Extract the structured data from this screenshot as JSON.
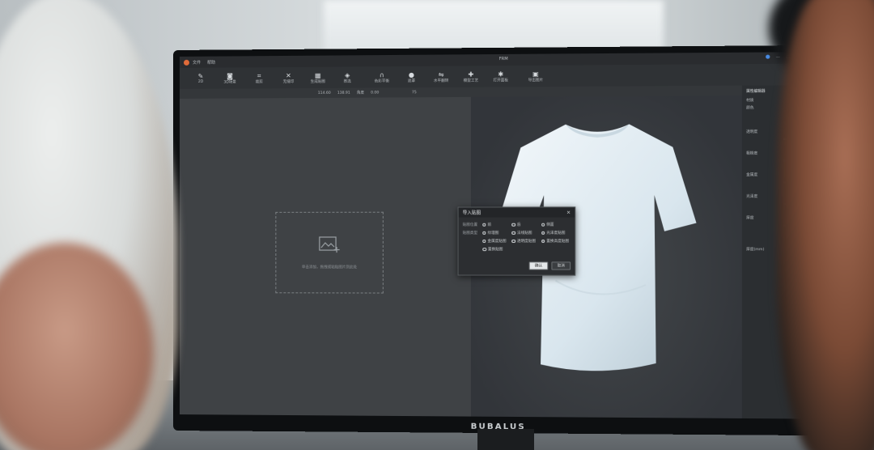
{
  "app": {
    "window_title": "FRM",
    "menu": [
      "文件",
      "帮助"
    ],
    "brand": "BUBALUS"
  },
  "toolbar": {
    "tools": [
      {
        "label": "2D",
        "icon": "pen-icon"
      },
      {
        "label": "3D场景",
        "icon": "camera-icon"
      },
      {
        "label": "裁剪",
        "icon": "crop-icon"
      },
      {
        "label": "无缝印",
        "icon": "pattern-icon"
      },
      {
        "label": "生成贴图",
        "icon": "grid-icon"
      },
      {
        "label": "拣选",
        "icon": "pick-icon"
      },
      {
        "label": "色彩平衡",
        "icon": "headphone-icon"
      },
      {
        "label": "遮罩",
        "icon": "person-icon"
      },
      {
        "label": "水平翻转",
        "icon": "flip-icon"
      },
      {
        "label": "模型工艺",
        "icon": "plus-icon"
      },
      {
        "label": "打开面板",
        "icon": "gear-icon"
      },
      {
        "label": "导出图片",
        "icon": "export-icon"
      }
    ]
  },
  "subbar": {
    "width_value": "114.60",
    "height_value": "138.91",
    "angle_label": "角度",
    "angle_value": "0.00",
    "zoom_value": "75"
  },
  "canvas2d": {
    "hint": "单击添加，拖拽或粘贴图片到此处"
  },
  "dialog": {
    "title": "导入贴图",
    "close": "✕",
    "row1_label": "贴图位置",
    "row1_options": [
      {
        "label": "前",
        "selected": false
      },
      {
        "label": "后",
        "selected": true
      },
      {
        "label": "侧面",
        "selected": false
      }
    ],
    "row2_label": "贴图类型",
    "row2_options": [
      {
        "label": "纹理图",
        "selected": false
      },
      {
        "label": "法线贴图",
        "selected": true
      },
      {
        "label": "光泽度贴图",
        "selected": true
      }
    ],
    "row3_options": [
      {
        "label": "金属度贴图",
        "selected": false
      },
      {
        "label": "透明度贴图",
        "selected": true
      },
      {
        "label": "置换高度贴图",
        "selected": true
      }
    ],
    "row4_options": [
      {
        "label": "置换贴图",
        "selected": false
      }
    ],
    "ok_label": "确认",
    "cancel_label": "取消"
  },
  "panel": {
    "title": "属性编辑器",
    "rows": [
      {
        "label": "材质",
        "value": "打开"
      },
      {
        "label": "颜色",
        "value": ""
      },
      {
        "label": "透明度",
        "value": "0.00"
      },
      {
        "label": "粗糙度",
        "value": "0.00"
      },
      {
        "label": "金属度",
        "value": "0.00"
      },
      {
        "label": "光泽度",
        "value": "0.00"
      },
      {
        "label": "厚度",
        "value": "1.00"
      },
      {
        "label": "厚度(mm)",
        "value": "0.50"
      }
    ]
  }
}
